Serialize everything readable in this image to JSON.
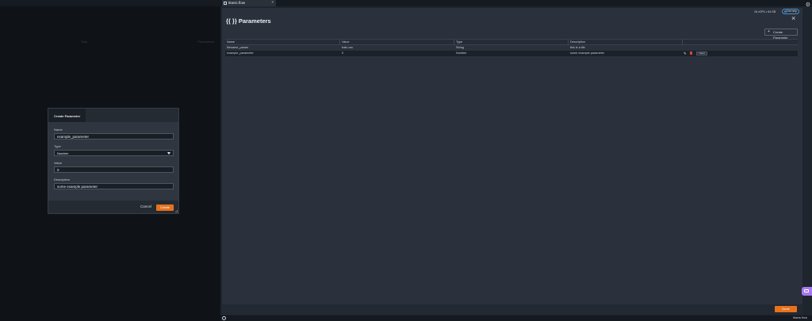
{
  "left": {
    "tabs": [
      "Task",
      "Parameters"
    ]
  },
  "dialog": {
    "title": "Create Parameter",
    "name_label": "Name",
    "name_value": "example_parameter",
    "type_label": "Type",
    "type_value": "Number",
    "value_label": "Value",
    "value_value": "0",
    "description_label": "Description",
    "description_value": "some example parameter",
    "cancel_label": "Cancel",
    "create_label": "Create"
  },
  "app": {
    "file_tab": "titanic.flow",
    "resources": "16 vCPU • 64 GB",
    "help_label": "Get help",
    "page_title": "{{ }} Parameters",
    "create_parameter_label": "Create Parameter",
    "done_label": "Done",
    "status_text": "titanic.flow"
  },
  "table": {
    "headers": [
      "Name",
      "Value",
      "Type",
      "Description"
    ],
    "rows": [
      {
        "name": "filename_param",
        "value": "train.csv",
        "type": "String",
        "description": "this is a file"
      },
      {
        "name": "example_parameter",
        "value": "0",
        "type": "Number",
        "description": "some example parameter",
        "action": "Insert"
      }
    ]
  },
  "colors": {
    "accent": "#e8721c",
    "danger": "#e0443c",
    "help_border": "#4a8fc7",
    "chat": "#a678f0"
  }
}
